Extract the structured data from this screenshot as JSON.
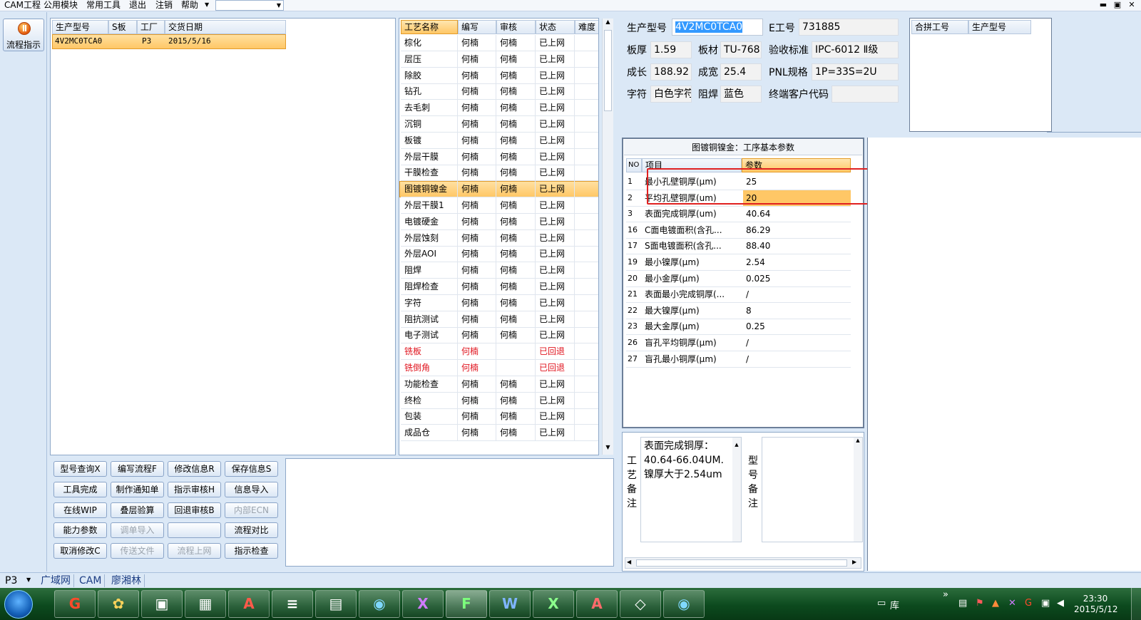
{
  "menu": {
    "items": [
      "CAM工程",
      "公用模块",
      "常用工具",
      "退出",
      "注销",
      "帮助"
    ],
    "window_buttons": [
      "▬",
      "▣",
      "✕"
    ]
  },
  "flow_button": {
    "label": "流程指示"
  },
  "job_table": {
    "headers": [
      "生产型号",
      "S板",
      "工厂",
      "交货日期"
    ],
    "rows": [
      {
        "model": "4V2MC0TCA0",
        "s": "",
        "factory": "P3",
        "date": "2015/5/16"
      }
    ]
  },
  "process_table": {
    "headers": [
      "工艺名称",
      "编写",
      "审核",
      "状态",
      "难度"
    ],
    "rows": [
      [
        "棕化",
        "何楠",
        "何楠",
        "已上网",
        ""
      ],
      [
        "层压",
        "何楠",
        "何楠",
        "已上网",
        ""
      ],
      [
        "除胶",
        "何楠",
        "何楠",
        "已上网",
        ""
      ],
      [
        "钻孔",
        "何楠",
        "何楠",
        "已上网",
        ""
      ],
      [
        "去毛刺",
        "何楠",
        "何楠",
        "已上网",
        ""
      ],
      [
        "沉铜",
        "何楠",
        "何楠",
        "已上网",
        ""
      ],
      [
        "板镀",
        "何楠",
        "何楠",
        "已上网",
        ""
      ],
      [
        "外层干膜",
        "何楠",
        "何楠",
        "已上网",
        ""
      ],
      [
        "干膜检查",
        "何楠",
        "何楠",
        "已上网",
        ""
      ],
      [
        "图镀铜镍金",
        "何楠",
        "何楠",
        "已上网",
        ""
      ],
      [
        "外层干膜1",
        "何楠",
        "何楠",
        "已上网",
        ""
      ],
      [
        "电镀硬金",
        "何楠",
        "何楠",
        "已上网",
        ""
      ],
      [
        "外层蚀刻",
        "何楠",
        "何楠",
        "已上网",
        ""
      ],
      [
        "外层AOI",
        "何楠",
        "何楠",
        "已上网",
        ""
      ],
      [
        "阻焊",
        "何楠",
        "何楠",
        "已上网",
        ""
      ],
      [
        "阻焊检查",
        "何楠",
        "何楠",
        "已上网",
        ""
      ],
      [
        "字符",
        "何楠",
        "何楠",
        "已上网",
        ""
      ],
      [
        "阻抗测试",
        "何楠",
        "何楠",
        "已上网",
        ""
      ],
      [
        "电子测试",
        "何楠",
        "何楠",
        "已上网",
        ""
      ],
      [
        "铣板",
        "何楠",
        "",
        "已回退",
        ""
      ],
      [
        "铣倒角",
        "何楠",
        "",
        "已回退",
        ""
      ],
      [
        "功能检查",
        "何楠",
        "何楠",
        "已上网",
        ""
      ],
      [
        "终检",
        "何楠",
        "何楠",
        "已上网",
        ""
      ],
      [
        "包装",
        "何楠",
        "何楠",
        "已上网",
        ""
      ],
      [
        "成品仓",
        "何楠",
        "何楠",
        "已上网",
        ""
      ]
    ],
    "selected_index": 9,
    "returned_indices": [
      19,
      20
    ]
  },
  "info": {
    "model_label": "生产型号",
    "model_value": "4V2MC0TCA0",
    "e_label": "E工号",
    "e_value": "731885",
    "thick_label": "板厚",
    "thick_value": "1.59",
    "material_label": "板材",
    "material_value": "TU-768",
    "accept_label": "验收标准",
    "accept_value": "IPC-6012 Ⅱ级",
    "length_label": "成长",
    "length_value": "188.92",
    "width_label": "成宽",
    "width_value": "25.4",
    "pnl_label": "PNL规格",
    "pnl_value": "1P=33S=2U",
    "char_label": "字符",
    "char_value": "白色字符",
    "mask_label": "阻焊",
    "mask_value": "蓝色",
    "customer_label": "终端客户代码",
    "customer_value": ""
  },
  "merge_table": {
    "headers": [
      "合拼工号",
      "生产型号"
    ]
  },
  "params": {
    "title": "图镀铜镍金：工序基本参数",
    "headers": [
      "NO",
      "项目",
      "参数"
    ],
    "rows": [
      [
        "1",
        "最小孔壁铜厚(μm)",
        "25"
      ],
      [
        "2",
        "平均孔壁铜厚(um)",
        "20"
      ],
      [
        "3",
        "表面完成铜厚(um)",
        "40.64"
      ],
      [
        "16",
        "C面电镀面积(含孔...",
        "86.29"
      ],
      [
        "17",
        "S面电镀面积(含孔...",
        "88.40"
      ],
      [
        "19",
        "最小镍厚(μm)",
        "2.54"
      ],
      [
        "20",
        "最小金厚(μm)",
        "0.025"
      ],
      [
        "21",
        "表面最小完成铜厚(...",
        "/"
      ],
      [
        "22",
        "最大镍厚(μm)",
        "8"
      ],
      [
        "23",
        "最大金厚(μm)",
        "0.25"
      ],
      [
        "26",
        "盲孔平均铜厚(μm)",
        "/"
      ],
      [
        "27",
        "盲孔最小铜厚(μm)",
        "/"
      ]
    ],
    "selected_index": 1
  },
  "notes": {
    "process_label": "工艺备注",
    "process_text": "表面完成铜厚：\n40.64-66.04UM.\n镍厚大于2.54um",
    "model_label": "型号备注"
  },
  "buttons": [
    {
      "label": "型号查询X",
      "disabled": false
    },
    {
      "label": "编写流程F",
      "disabled": false
    },
    {
      "label": "修改信息R",
      "disabled": false
    },
    {
      "label": "保存信息S",
      "disabled": false
    },
    {
      "label": "工具完成",
      "disabled": false
    },
    {
      "label": "制作通知单",
      "disabled": false
    },
    {
      "label": "指示审核H",
      "disabled": false
    },
    {
      "label": "信息导入",
      "disabled": false
    },
    {
      "label": "在线WIP",
      "disabled": false
    },
    {
      "label": "叠层验算",
      "disabled": false
    },
    {
      "label": "回退审核B",
      "disabled": false
    },
    {
      "label": "内部ECN",
      "disabled": true
    },
    {
      "label": "能力参数",
      "disabled": false
    },
    {
      "label": "调单导入",
      "disabled": true
    },
    {
      "label": "",
      "disabled": true
    },
    {
      "label": "流程对比",
      "disabled": false
    },
    {
      "label": "取消修改C",
      "disabled": false
    },
    {
      "label": "传送文件",
      "disabled": true
    },
    {
      "label": "流程上网",
      "disabled": true
    },
    {
      "label": "指示检查",
      "disabled": false
    }
  ],
  "status": {
    "factory": "P3",
    "tabs": [
      "广域网",
      "CAM",
      "廖湘林"
    ]
  },
  "taskbar": {
    "tray_label": "库",
    "time": "23:30",
    "date": "2015/5/12"
  }
}
